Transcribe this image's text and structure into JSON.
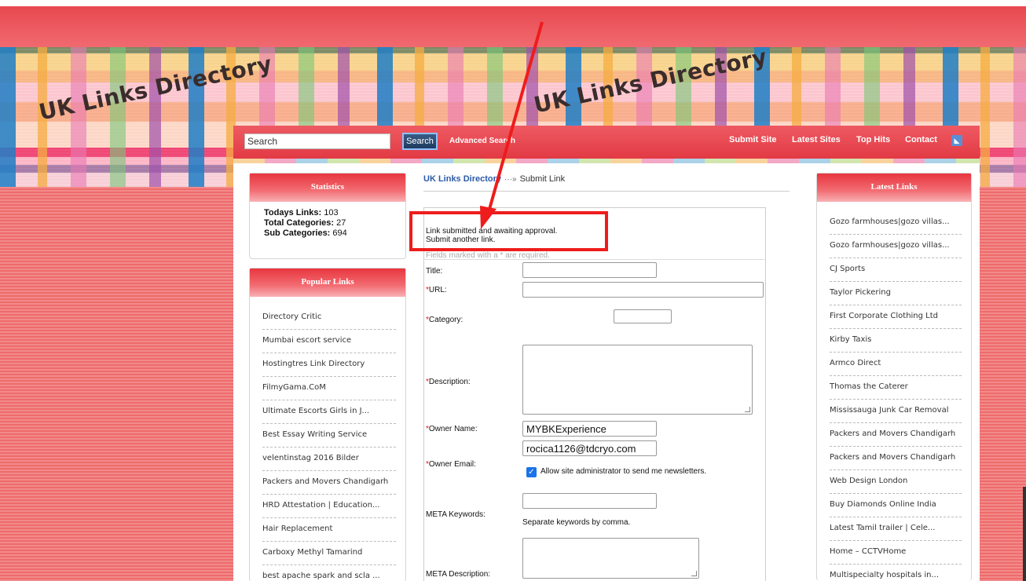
{
  "banner": {
    "logo_text": "UK Links Directory"
  },
  "navbar": {
    "search_placeholder": "Search",
    "search_button": "Search",
    "advanced_search": "Advanced Search",
    "links": [
      "Submit Site",
      "Latest Sites",
      "Top Hits",
      "Contact"
    ]
  },
  "statistics": {
    "title": "Statistics",
    "todays_links_label": "Todays Links:",
    "todays_links_value": "103",
    "total_categories_label": "Total Categories:",
    "total_categories_value": "27",
    "sub_categories_label": "Sub Categories:",
    "sub_categories_value": "694"
  },
  "popular": {
    "title": "Popular Links",
    "items": [
      "Directory Critic",
      "Mumbai escort service",
      "Hostingtres Link Directory",
      "FilmyGama.CoM",
      "Ultimate Escorts Girls in J...",
      "Best Essay Writing Service",
      "velentinstag 2016 Bilder",
      "Packers and Movers Chandigarh",
      "HRD Attestation | Education...",
      "Hair Replacement",
      "Carboxy Methyl Tamarind",
      "best apache spark and scla ..."
    ]
  },
  "latest": {
    "title": "Latest Links",
    "items": [
      "Gozo farmhouses|gozo villas...",
      "Gozo farmhouses|gozo villas...",
      "CJ Sports",
      "Taylor Pickering",
      "First Corporate Clothing Ltd",
      "Kirby Taxis",
      "Armco Direct",
      "Thomas the Caterer",
      "Mississauga Junk Car Removal",
      "Packers and Movers Chandigarh",
      "Packers and Movers Chandigarh",
      "Web Design London",
      "Buy Diamonds Online India",
      "Latest Tamil trailer | Cele...",
      "Home – CCTVHome",
      "Multispecialty hospitals in..."
    ]
  },
  "breadcrumb": {
    "home": "UK Links Directory",
    "separator": "···»",
    "current": "Submit Link"
  },
  "form": {
    "success_line1": "Link submitted and awaiting approval.",
    "success_line2": "Submit another link.",
    "required_note": "Fields marked with a * are required.",
    "labels": {
      "title": "Title:",
      "url": "URL:",
      "category": "Category:",
      "description": "Description:",
      "owner_name": "Owner Name:",
      "owner_email": "Owner Email:",
      "meta_keywords": "META Keywords:",
      "meta_description": "META Description:"
    },
    "required_mark": "*",
    "values": {
      "title": "",
      "url": "",
      "owner_name": "MYBKExperience",
      "owner_email": "rocica1126@tdcryo.com",
      "meta_keywords": ""
    },
    "newsletter_label": "Allow site administrator to send me newsletters.",
    "newsletter_checked": true,
    "keywords_hint": "Separate keywords by comma."
  },
  "colors": {
    "header_red": "#e23a44",
    "link_blue": "#2b5aa8",
    "annotation_red": "#ee1c1c"
  }
}
